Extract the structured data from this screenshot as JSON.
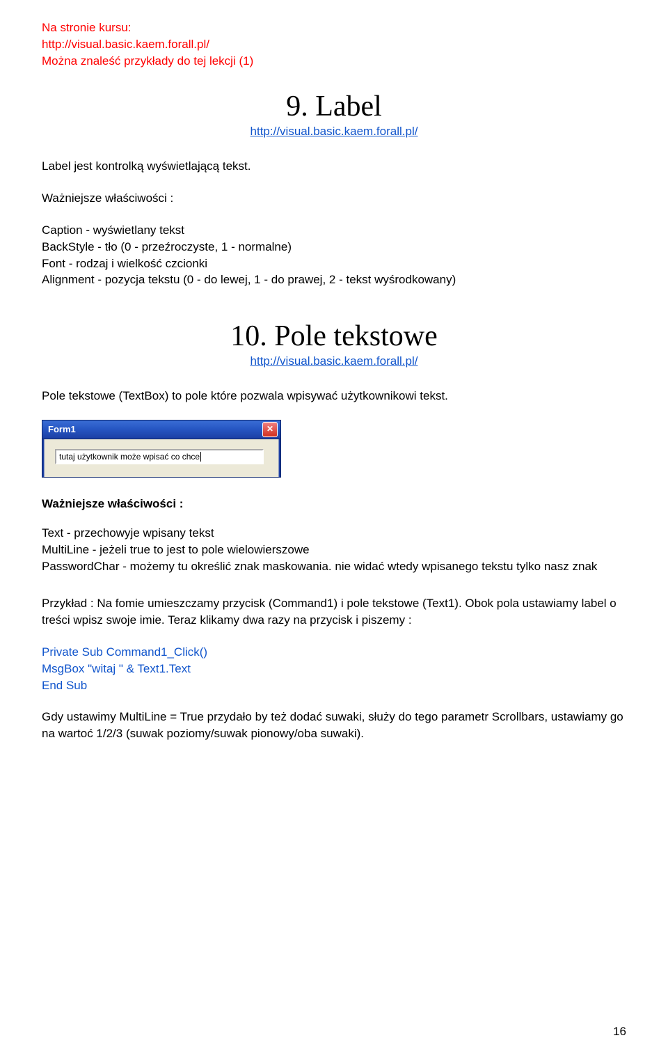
{
  "top": {
    "line1": "Na stronie kursu:",
    "line2": "http://visual.basic.kaem.forall.pl/",
    "line3": "Można znaleść przykłady do tej lekcji (1)"
  },
  "section9": {
    "title": "9. Label",
    "link": "http://visual.basic.kaem.forall.pl/",
    "intro": "Label jest kontrolką wyświetlającą tekst.",
    "propsHead": "Ważniejsze właściwości :",
    "p1": "Caption - wyświetlany tekst",
    "p2": "BackStyle - tło (0 - przeźroczyste, 1 - normalne)",
    "p3": "Font - rodzaj i wielkość czcionki",
    "p4": "Alignment - pozycja tekstu (0 - do lewej, 1 - do prawej, 2 - tekst wyśrodkowany)"
  },
  "section10": {
    "title": "10. Pole tekstowe",
    "link": "http://visual.basic.kaem.forall.pl/",
    "intro": "Pole tekstowe (TextBox) to pole które pozwala wpisywać użytkownikowi tekst.",
    "window": {
      "title": "Form1",
      "textbox_value": "tutaj użytkownik może wpisać co chce"
    },
    "propsHead": "Ważniejsze właściwości :",
    "p1": "Text - przechowyje wpisany tekst",
    "p2": "MultiLine - jeżeli true to jest to pole wielowierszowe",
    "p3": "PasswordChar - możemy tu określić znak maskowania. nie widać wtedy wpisanego tekstu tylko nasz znak",
    "example": "Przykład : Na fomie umieszczamy przycisk (Command1) i pole tekstowe (Text1). Obok pola ustawiamy label o treści wpisz swoje imie. Teraz klikamy dwa razy na przycisk i piszemy :",
    "code1": "Private Sub Command1_Click()",
    "code2": "MsgBox \"witaj \" & Text1.Text",
    "code3": "End Sub",
    "after": "Gdy ustawimy MultiLine = True przydało by też dodać suwaki, służy do tego parametr Scrollbars, ustawiamy go na warto\u001ać 1/2/3 (suwak poziomy/suwak pionowy/oba suwaki)."
  },
  "pageNumber": "16"
}
